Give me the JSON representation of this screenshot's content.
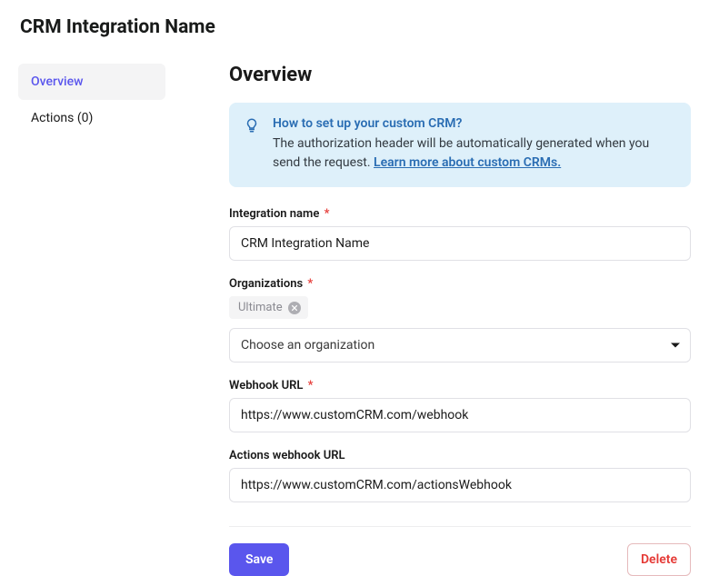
{
  "page": {
    "title": "CRM Integration Name"
  },
  "sidebar": {
    "items": [
      {
        "label": "Overview",
        "active": true
      },
      {
        "label": "Actions (0)",
        "active": false
      }
    ]
  },
  "main": {
    "heading": "Overview",
    "info": {
      "title": "How to set up your custom CRM?",
      "body_prefix": "The authorization header will be automatically generated when you send the request. ",
      "link_text": "Learn more about custom CRMs."
    },
    "fields": {
      "integration_name": {
        "label": "Integration name",
        "required": true,
        "value": "CRM Integration Name"
      },
      "organizations": {
        "label": "Organizations",
        "required": true,
        "tags": [
          {
            "label": "Ultimate"
          }
        ],
        "placeholder": "Choose an organization"
      },
      "webhook_url": {
        "label": "Webhook URL",
        "required": true,
        "value": "https://www.customCRM.com/webhook"
      },
      "actions_webhook_url": {
        "label": "Actions webhook URL",
        "required": false,
        "value": "https://www.customCRM.com/actionsWebhook"
      }
    },
    "actions": {
      "save": "Save",
      "delete": "Delete"
    }
  },
  "required_marker": "*"
}
